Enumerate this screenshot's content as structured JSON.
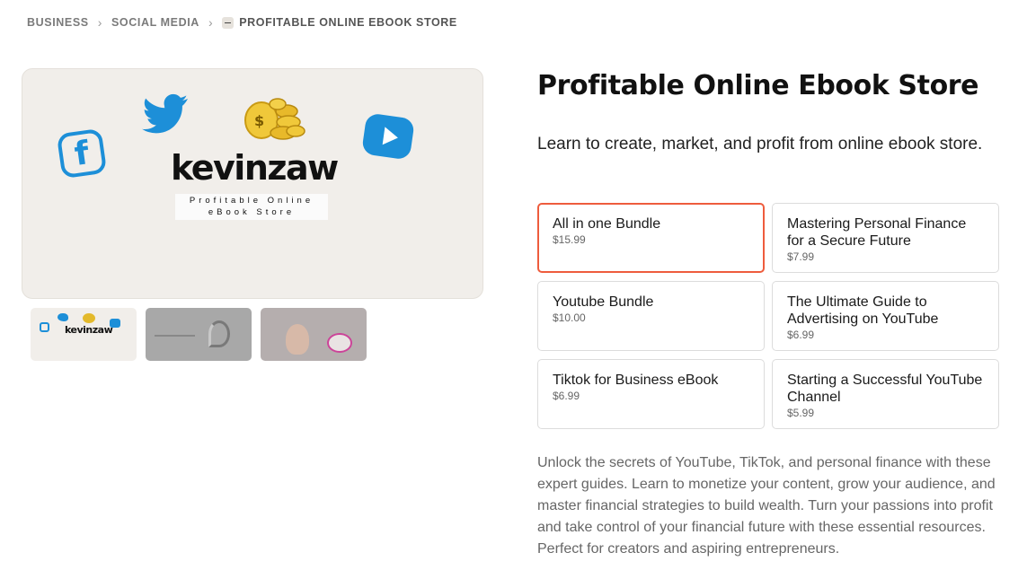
{
  "breadcrumb": {
    "items": [
      "BUSINESS",
      "SOCIAL MEDIA"
    ],
    "current": "PROFITABLE ONLINE EBOOK STORE"
  },
  "hero": {
    "brand": "kevinzaw",
    "tagline_line1": "Profitable Online",
    "tagline_line2": "eBook Store",
    "thumb_brand": "kevinzaw"
  },
  "product": {
    "title": "Profitable Online Ebook Store",
    "subtitle": "Learn to create, market, and profit from online ebook store.",
    "description": "Unlock the secrets of YouTube, TikTok, and personal finance with these expert guides. Learn to monetize your content, grow your audience, and master financial strategies to build wealth. Turn your passions into profit and take control of your financial future with these essential resources. Perfect for creators and aspiring entrepreneurs."
  },
  "variants": [
    {
      "name": "All in one Bundle",
      "price": "$15.99"
    },
    {
      "name": "Mastering Personal Finance for a Secure Future",
      "price": "$7.99"
    },
    {
      "name": "Youtube Bundle",
      "price": "$10.00"
    },
    {
      "name": "The Ultimate Guide to Advertising on YouTube",
      "price": "$6.99"
    },
    {
      "name": "Tiktok for Business eBook",
      "price": "$6.99"
    },
    {
      "name": "Starting a Successful YouTube Channel",
      "price": "$5.99"
    }
  ],
  "colors": {
    "accent_selected_border": "#ee5c3d",
    "social_blue": "#1d8fd8",
    "hero_bg": "#f1eeea"
  },
  "icons": [
    "chevron-right-icon",
    "facebook-icon",
    "twitter-icon",
    "coins-icon",
    "youtube-play-icon"
  ]
}
